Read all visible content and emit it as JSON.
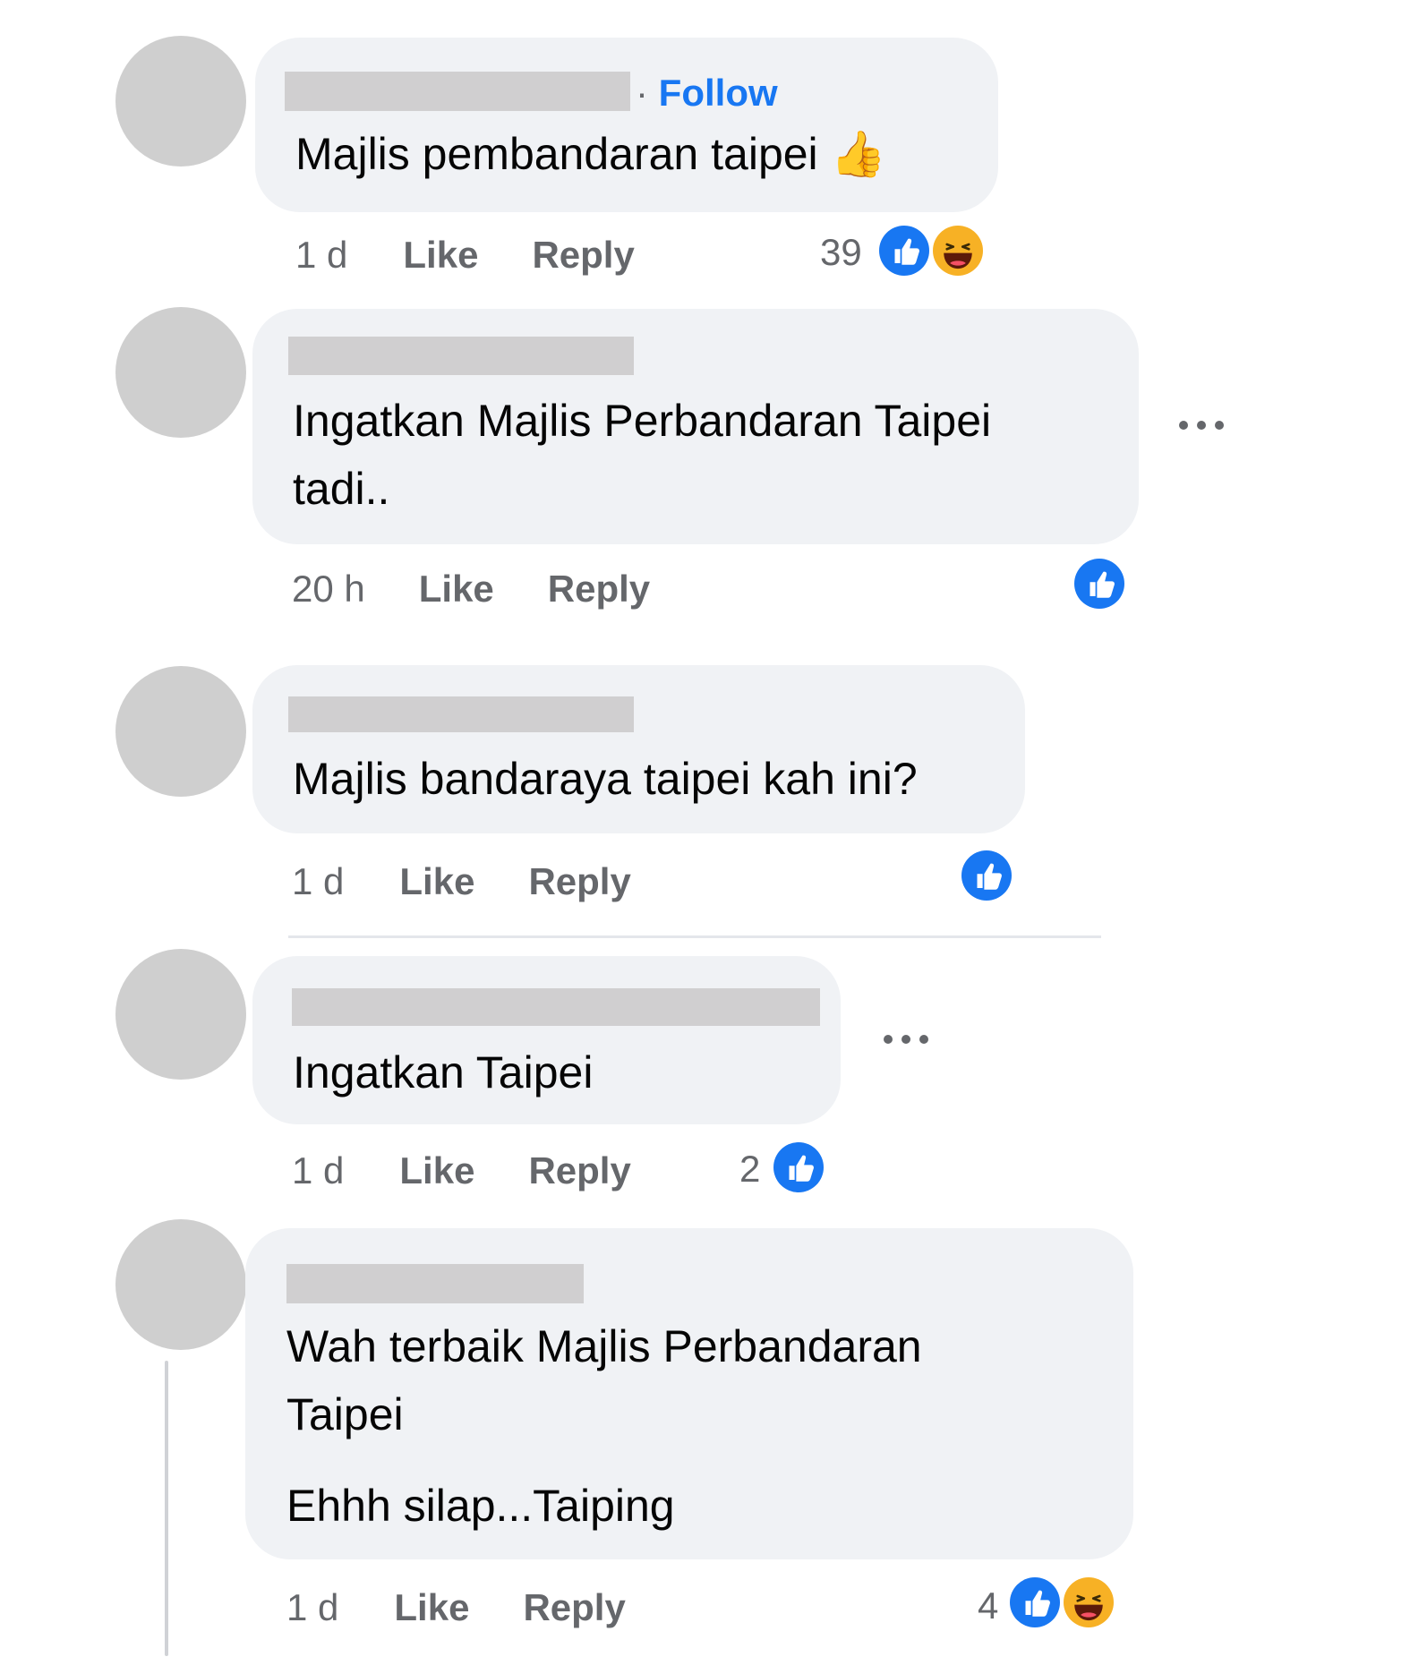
{
  "colors": {
    "bubble": "#f0f2f5",
    "text": "#050505",
    "secondary": "#65676b",
    "link": "#1877f2",
    "like_blue": "#1877f2",
    "haha_yellow": "#f7b125"
  },
  "comments": [
    {
      "follow_separator": "·",
      "follow_label": "Follow",
      "text_lines": [
        "Majlis pembandaran taipei 👍"
      ],
      "time": "1 d",
      "like_label": "Like",
      "reply_label": "Reply",
      "reaction_count": "39",
      "reactions": [
        "like-icon",
        "haha-icon"
      ]
    },
    {
      "text_lines": [
        "Ingatkan Majlis Perbandaran Taipei",
        "tadi.."
      ],
      "time": "20 h",
      "like_label": "Like",
      "reply_label": "Reply",
      "reaction_count": "",
      "reactions": [
        "like-icon"
      ]
    },
    {
      "text_lines": [
        "Majlis bandaraya taipei kah ini?"
      ],
      "time": "1 d",
      "like_label": "Like",
      "reply_label": "Reply",
      "reaction_count": "",
      "reactions": [
        "like-icon"
      ]
    },
    {
      "text_lines": [
        "Ingatkan Taipei"
      ],
      "time": "1 d",
      "like_label": "Like",
      "reply_label": "Reply",
      "reaction_count": "2",
      "reactions": [
        "like-icon"
      ]
    },
    {
      "text_lines": [
        "Wah terbaik Majlis Perbandaran",
        "Taipei",
        "Ehhh silap...Taiping"
      ],
      "time": "1 d",
      "like_label": "Like",
      "reply_label": "Reply",
      "reaction_count": "4",
      "reactions": [
        "like-icon",
        "haha-icon"
      ]
    }
  ]
}
